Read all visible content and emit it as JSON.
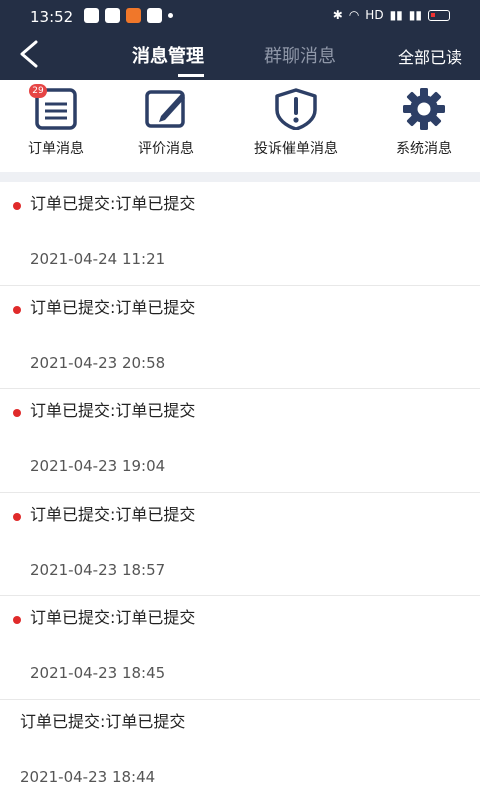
{
  "status_bar": {
    "time": "13:52",
    "network_label": "HD"
  },
  "header": {
    "tabs": [
      {
        "label": "消息管理",
        "active": true
      },
      {
        "label": "群聊消息",
        "active": false
      }
    ],
    "mark_all_read": "全部已读"
  },
  "categories": [
    {
      "label": "订单消息",
      "icon": "order-document-icon",
      "badge": "29"
    },
    {
      "label": "评价消息",
      "icon": "edit-review-icon"
    },
    {
      "label": "投诉催单消息",
      "icon": "complaint-shield-icon"
    },
    {
      "label": "系统消息",
      "icon": "settings-gear-icon"
    }
  ],
  "messages": [
    {
      "title": "订单已提交:订单已提交",
      "time": "2021-04-24 11:21",
      "unread": true
    },
    {
      "title": "订单已提交:订单已提交",
      "time": "2021-04-23 20:58",
      "unread": true
    },
    {
      "title": "订单已提交:订单已提交",
      "time": "2021-04-23 19:04",
      "unread": true
    },
    {
      "title": "订单已提交:订单已提交",
      "time": "2021-04-23 18:57",
      "unread": true
    },
    {
      "title": "订单已提交:订单已提交",
      "time": "2021-04-23 18:45",
      "unread": true
    },
    {
      "title": "订单已提交:订单已提交",
      "time": "2021-04-23 18:44",
      "unread": false
    }
  ],
  "colors": {
    "header_bg": "#242f45",
    "icon_color": "#2d3f66",
    "unread_dot": "#e02a2a",
    "badge": "#e64545"
  }
}
